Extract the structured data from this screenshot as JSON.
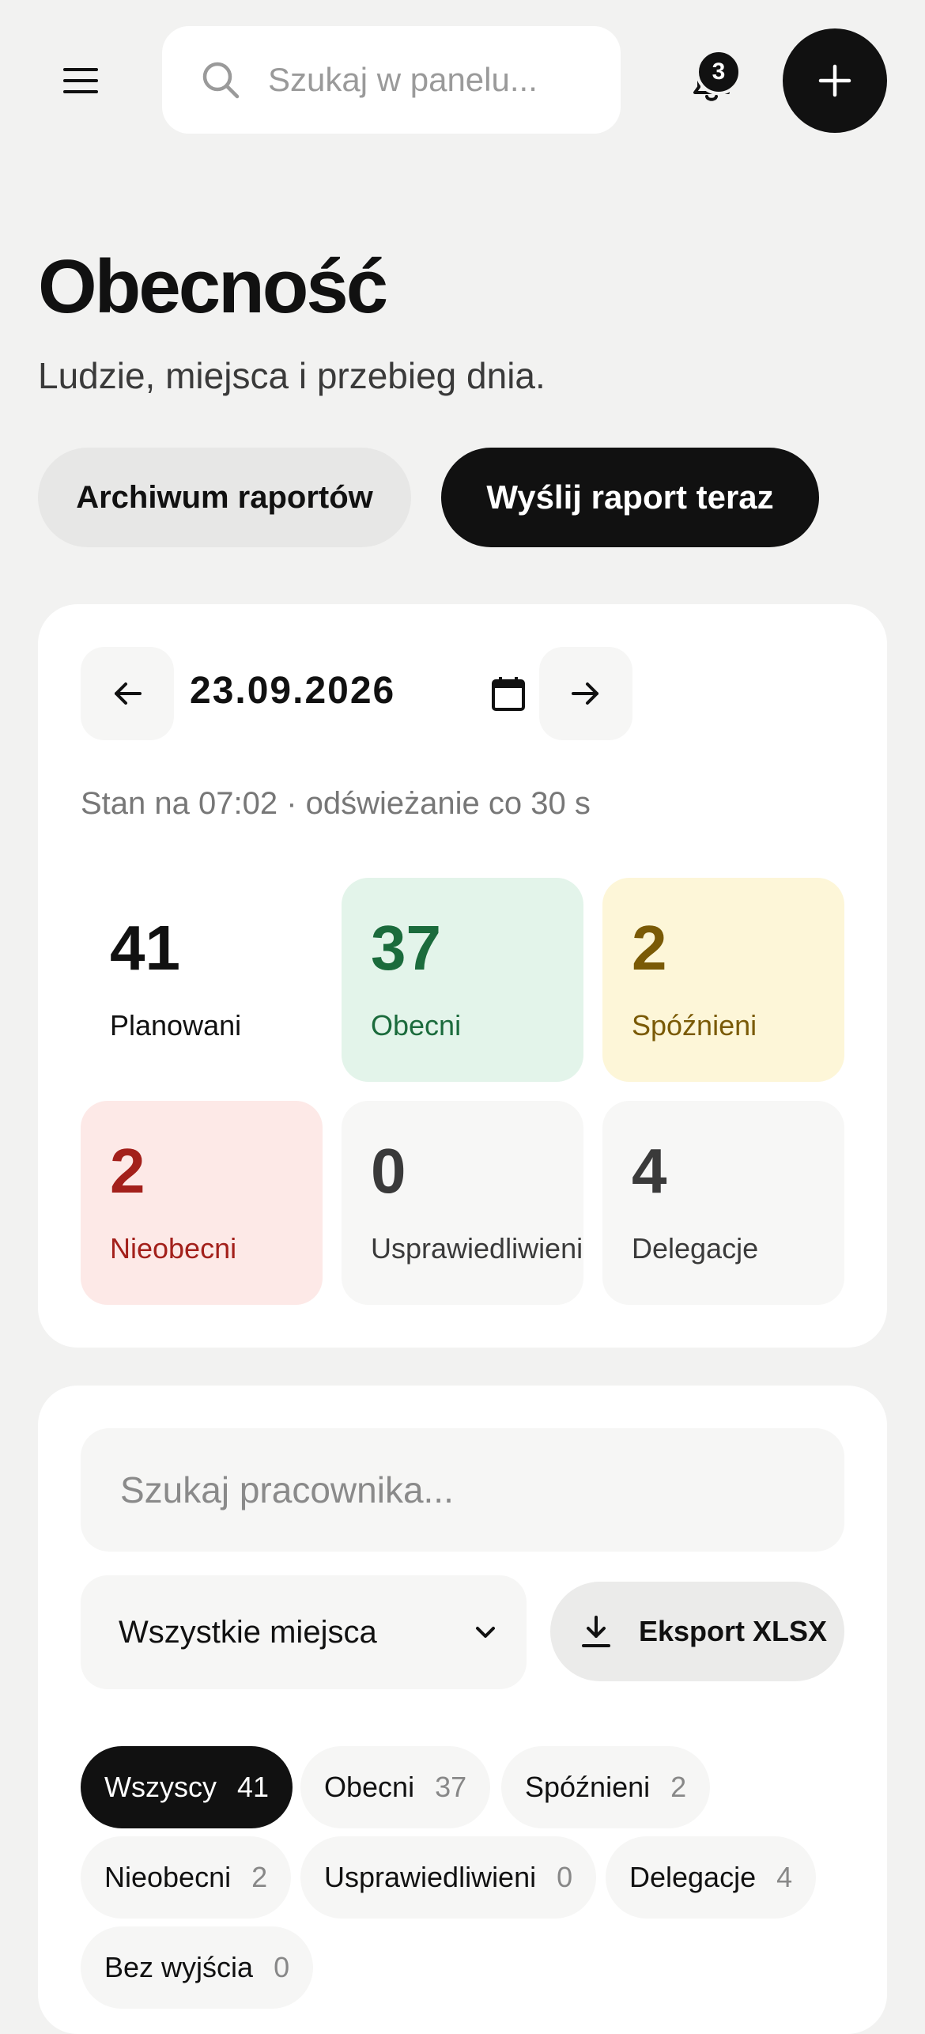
{
  "topbar": {
    "search_placeholder": "Szukaj w panelu...",
    "notifications_count": "3"
  },
  "header": {
    "title": "Obecność",
    "subtitle": "Ludzie, miejsca i przebieg dnia.",
    "archive_label": "Archiwum raportów",
    "send_label": "Wyślij raport teraz"
  },
  "summary": {
    "date": "23.09.2026",
    "status": "Stan na 07:02 · odświeżanie co 30 s",
    "stats": [
      {
        "value": "41",
        "label": "Planowani",
        "bg": "#ffffff",
        "color": "#111111"
      },
      {
        "value": "37",
        "label": "Obecni",
        "bg": "#e3f4ea",
        "color": "#1b6b3c"
      },
      {
        "value": "2",
        "label": "Spóźnieni",
        "bg": "#fdf6d8",
        "color": "#7a5a06"
      },
      {
        "value": "2",
        "label": "Nieobecni",
        "bg": "#fde9e7",
        "color": "#a3201b"
      },
      {
        "value": "0",
        "label": "Usprawiedliwieni",
        "bg": "#f7f7f6",
        "color": "#3a3a3a"
      },
      {
        "value": "4",
        "label": "Delegacje",
        "bg": "#f7f7f6",
        "color": "#3a3a3a"
      }
    ]
  },
  "list": {
    "search_placeholder": "Szukaj pracownika...",
    "place_select": "Wszystkie miejsca",
    "export_label": "Eksport XLSX",
    "filters": [
      {
        "label": "Wszyscy",
        "count": "41",
        "active": true
      },
      {
        "label": "Obecni",
        "count": "37"
      },
      {
        "label": "Spóźnieni",
        "count": "2"
      },
      {
        "label": "Nieobecni",
        "count": "2"
      },
      {
        "label": "Usprawiedliwieni",
        "count": "0"
      },
      {
        "label": "Delegacje",
        "count": "4"
      },
      {
        "label": "Bez wyjścia",
        "count": "0"
      }
    ]
  }
}
